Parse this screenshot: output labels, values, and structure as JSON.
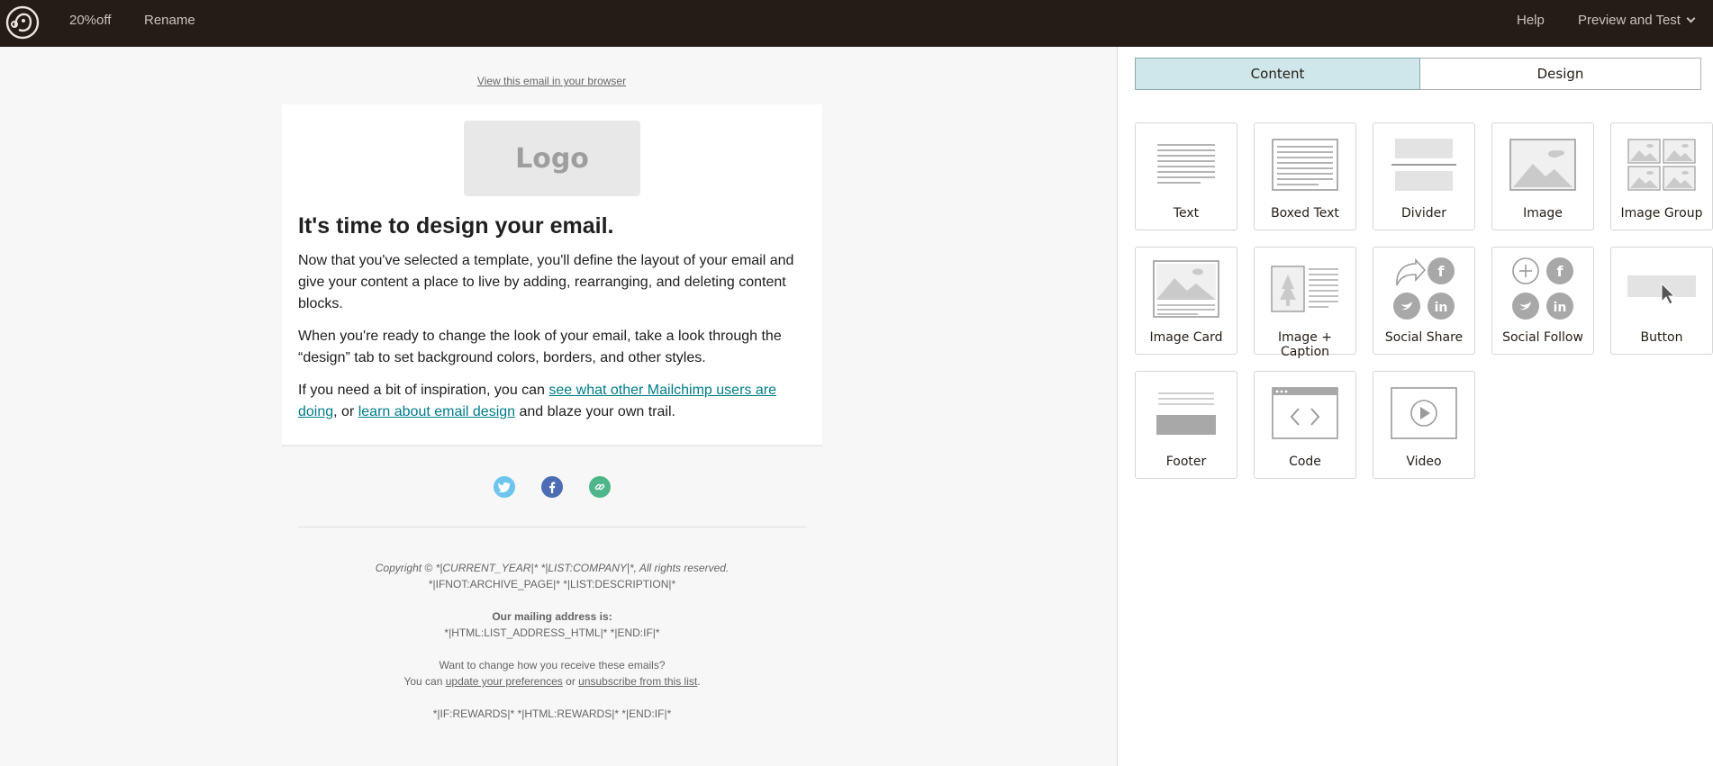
{
  "topbar": {
    "campaign_name": "20%off",
    "rename_label": "Rename",
    "help_label": "Help",
    "preview_label": "Preview and Test"
  },
  "email": {
    "view_in_browser": "View this email in your browser",
    "logo_text": "Logo",
    "heading": "It's time to design your email.",
    "para1": "Now that you've selected a template, you'll define the layout of your email and give your content a place to live by adding, rearranging, and deleting content blocks.",
    "para2": "When you're ready to change the look of your email, take a look through the “design” tab to set background colors, borders, and other styles.",
    "para3_prefix": "If you need a bit of inspiration, you can ",
    "para3_link1": "see what other Mailchimp users are doing",
    "para3_mid": ", or ",
    "para3_link2": "learn about email design",
    "para3_suffix": " and blaze your own trail."
  },
  "footer": {
    "copyright": "Copyright © *|CURRENT_YEAR|* *|LIST:COMPANY|*, All rights reserved.",
    "list_description": "*|IFNOT:ARCHIVE_PAGE|* *|LIST:DESCRIPTION|*",
    "mailing_heading": "Our mailing address is:",
    "mailing_address": "*|HTML:LIST_ADDRESS_HTML|* *|END:IF|*",
    "change_question": "Want to change how you receive these emails?",
    "you_can": "You can ",
    "update_prefs": "update your preferences",
    "or": " or ",
    "unsubscribe": "unsubscribe from this list",
    "period": ".",
    "rewards": "*|IF:REWARDS|* *|HTML:REWARDS|* *|END:IF|*"
  },
  "panel": {
    "tabs": [
      {
        "label": "Content"
      },
      {
        "label": "Design"
      }
    ],
    "blocks": [
      {
        "label": "Text",
        "icon": "text-block-icon"
      },
      {
        "label": "Boxed Text",
        "icon": "boxed-text-block-icon"
      },
      {
        "label": "Divider",
        "icon": "divider-block-icon"
      },
      {
        "label": "Image",
        "icon": "image-block-icon"
      },
      {
        "label": "Image Group",
        "icon": "image-group-block-icon"
      },
      {
        "label": "Image Card",
        "icon": "image-card-block-icon"
      },
      {
        "label": "Image + Caption",
        "icon": "image-caption-block-icon"
      },
      {
        "label": "Social Share",
        "icon": "social-share-block-icon"
      },
      {
        "label": "Social Follow",
        "icon": "social-follow-block-icon"
      },
      {
        "label": "Button",
        "icon": "button-block-icon"
      },
      {
        "label": "Footer",
        "icon": "footer-block-icon"
      },
      {
        "label": "Code",
        "icon": "code-block-icon"
      },
      {
        "label": "Video",
        "icon": "video-block-icon"
      }
    ]
  }
}
